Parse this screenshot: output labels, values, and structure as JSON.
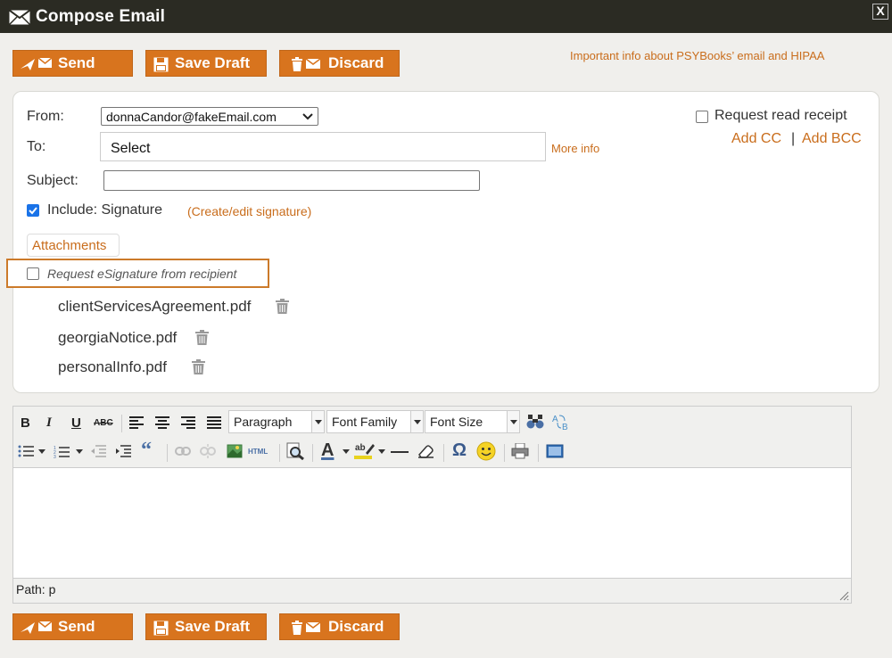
{
  "window": {
    "title": "Compose Email",
    "close_label": "X"
  },
  "toolbar_top": {
    "send_label": "Send",
    "save_draft_label": "Save Draft",
    "discard_label": "Discard"
  },
  "info_link": "Important info about PSYBooks’ email and HIPAA",
  "form": {
    "from_label": "From:",
    "from_value": "donnaCandor@fakeEmail.com",
    "to_label": "To:",
    "to_value": "Select",
    "more_info_label": "More info",
    "subject_label": "Subject:",
    "subject_value": "",
    "include_label": "Include: Signature",
    "include_checked": true,
    "edit_signature_label": "(Create/edit signature)",
    "read_receipt_label": "Request read receipt",
    "read_receipt_checked": false,
    "add_cc_label": "Add CC",
    "separator": "|",
    "add_bcc_label": "Add BCC",
    "attachments_label": "Attachments",
    "esignature_label": "Request eSignature from recipient",
    "esignature_checked": false,
    "files": [
      "clientServicesAgreement.pdf",
      "georgiaNotice.pdf",
      "personalInfo.pdf"
    ]
  },
  "editor": {
    "format_select": "Paragraph",
    "font_family_select": "Font Family",
    "font_size_select": "Font Size",
    "bold": "B",
    "italic": "I",
    "underline": "U",
    "strikethrough": "ABC",
    "html_button": "HTML",
    "text_color_glyph": "A",
    "special_char_glyph": "Ω",
    "path_label": "Path: p"
  },
  "toolbar_bottom": {
    "send_label": "Send",
    "save_draft_label": "Save Draft",
    "discard_label": "Discard"
  },
  "colors": {
    "accent": "#d8741e",
    "link": "#c96d1c",
    "titlebar": "#2b2b23",
    "checkbox_on": "#1a73e8"
  }
}
